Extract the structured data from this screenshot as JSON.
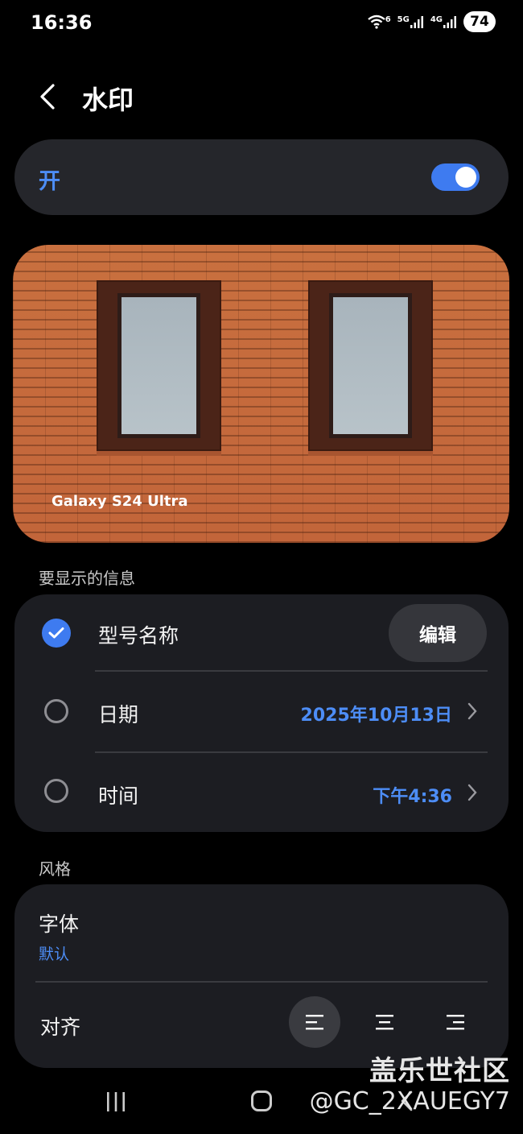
{
  "status_bar": {
    "time": "16:36",
    "wifi_label": "6",
    "sim1_label": "5G",
    "sim2_label": "4G",
    "battery": "74"
  },
  "header": {
    "title": "水印"
  },
  "master_toggle": {
    "label": "开",
    "on": true
  },
  "preview": {
    "watermark_text": "Galaxy S24 Ultra"
  },
  "info_section": {
    "heading": "要显示的信息",
    "model": {
      "label": "型号名称",
      "checked": true,
      "edit_label": "编辑"
    },
    "date": {
      "label": "日期",
      "checked": false,
      "value": "2025年10月13日"
    },
    "time": {
      "label": "时间",
      "checked": false,
      "value": "下午4:36"
    }
  },
  "style_section": {
    "heading": "风格",
    "font": {
      "label": "字体",
      "value": "默认"
    },
    "align": {
      "label": "对齐",
      "selected": "left"
    }
  },
  "overlay": {
    "logo_text": "盖乐世社区",
    "user_tag": "@GC_2XAUEGY7"
  },
  "colors": {
    "accent": "#3e7bf0",
    "accent_text": "#4d8df6",
    "card": "#1c1d22"
  }
}
